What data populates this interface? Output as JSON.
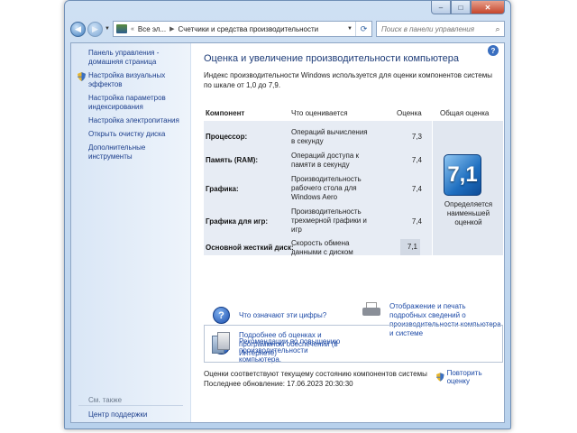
{
  "window": {
    "close": "✕",
    "minimize": "–",
    "maximize": "□"
  },
  "nav": {
    "breadcrumb": [
      "Все эл...",
      "Счетчики и средства производительности"
    ],
    "search_placeholder": "Поиск в панели управления"
  },
  "sidebar": {
    "home": "Панель управления - домашняя страница",
    "items": [
      {
        "label": "Настройка визуальных эффектов",
        "shield": true
      },
      {
        "label": "Настройка параметров индексирования",
        "shield": false
      },
      {
        "label": "Настройка электропитания",
        "shield": false
      },
      {
        "label": "Открыть очистку диска",
        "shield": false
      },
      {
        "label": "Дополнительные инструменты",
        "shield": false
      }
    ],
    "see_also": "См. также",
    "support": "Центр поддержки"
  },
  "main": {
    "title": "Оценка и увеличение производительности компьютера",
    "intro": "Индекс производительности Windows используется для оценки компонентов системы по шкале от 1,0 до 7,9.",
    "table": {
      "headers": [
        "Компонент",
        "Что оценивается",
        "Оценка",
        "Общая оценка"
      ],
      "rows": [
        {
          "component": "Процессор:",
          "what": "Операций вычисления в секунду",
          "score": "7,3"
        },
        {
          "component": "Память (RAM):",
          "what": "Операций доступа к памяти в секунду",
          "score": "7,4"
        },
        {
          "component": "Графика:",
          "what": "Производительность рабочего стола для Windows Aero",
          "score": "7,4"
        },
        {
          "component": "Графика для игр:",
          "what": "Производительность трехмерной графики и игр",
          "score": "7,4"
        },
        {
          "component": "Основной жесткий диск:",
          "what": "Скорость обмена данными с диском",
          "score": "7,1"
        }
      ],
      "overall": {
        "score": "7,1",
        "caption": "Определяется наименьшей оценкой"
      }
    },
    "links": {
      "what_numbers": "Что означают эти цифры?",
      "print": "Отображение и печать подробных сведений о производительности компьютера и системе",
      "tips": "Рекомендации по повышению производительности компьютера.",
      "more_info": "Подробнее об оценках и программном обеспечении (в Интернете)"
    },
    "status": "Оценки соответствуют текущему состоянию компонентов системы",
    "last_update": "Последнее обновление: 17.06.2023 20:30:30",
    "rerun": "Повторить оценку"
  }
}
